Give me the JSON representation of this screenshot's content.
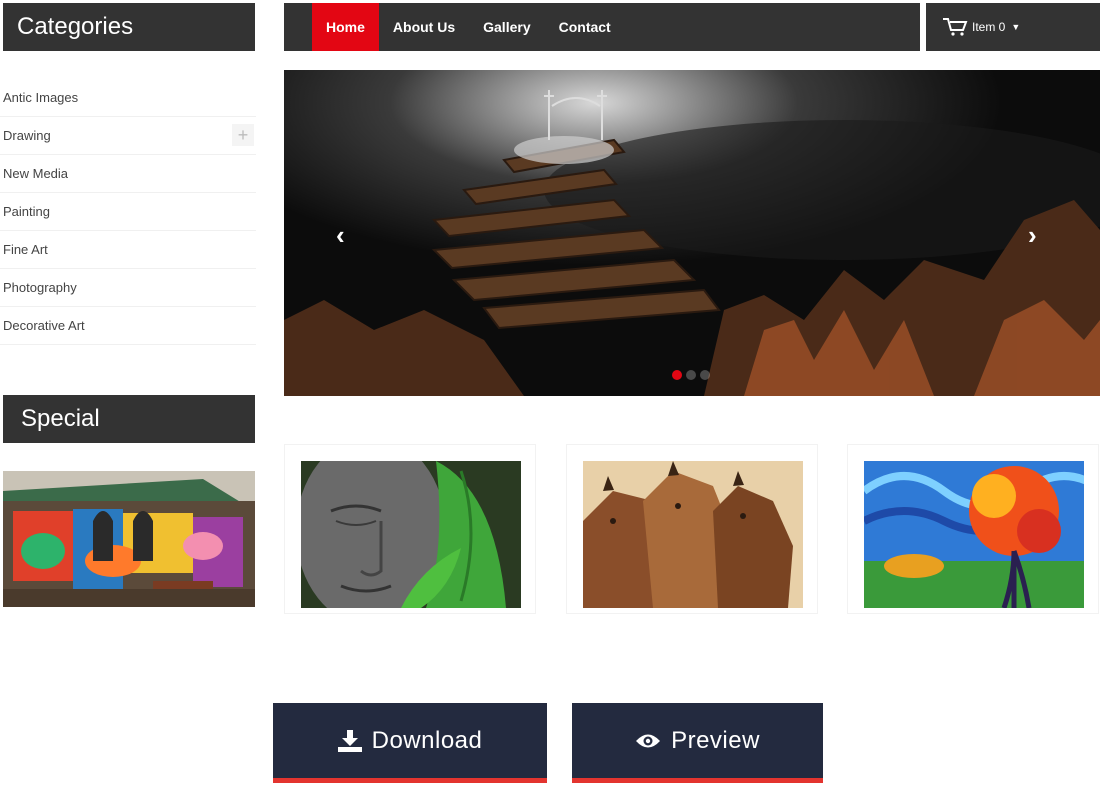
{
  "sidebar": {
    "categories_title": "Categories",
    "categories": [
      {
        "label": "Antic Images"
      },
      {
        "label": "Drawing",
        "expand": "+"
      },
      {
        "label": "New Media"
      },
      {
        "label": "Painting"
      },
      {
        "label": "Fine Art"
      },
      {
        "label": "Photography"
      },
      {
        "label": "Decorative Art"
      }
    ],
    "special_title": "Special"
  },
  "nav": {
    "items": [
      {
        "label": "Home",
        "active": true
      },
      {
        "label": "About Us"
      },
      {
        "label": "Gallery"
      },
      {
        "label": "Contact"
      }
    ],
    "cart_label": "Item 0",
    "cart_icon": "shopping-cart-icon",
    "caret_icon": "caret-down-icon"
  },
  "slider": {
    "prev_icon": "chevron-left-icon",
    "next_icon": "chevron-right-icon",
    "prev": "‹",
    "next": "›",
    "slide_count": 3,
    "active_slide": 1
  },
  "actions": {
    "download_label": "Download",
    "download_icon": "download-icon",
    "preview_label": "Preview",
    "preview_icon": "eye-icon"
  },
  "colors": {
    "nav_bg": "#333333",
    "active": "#e30613",
    "button_bg": "#232a3f",
    "button_accent": "#e3342f"
  }
}
